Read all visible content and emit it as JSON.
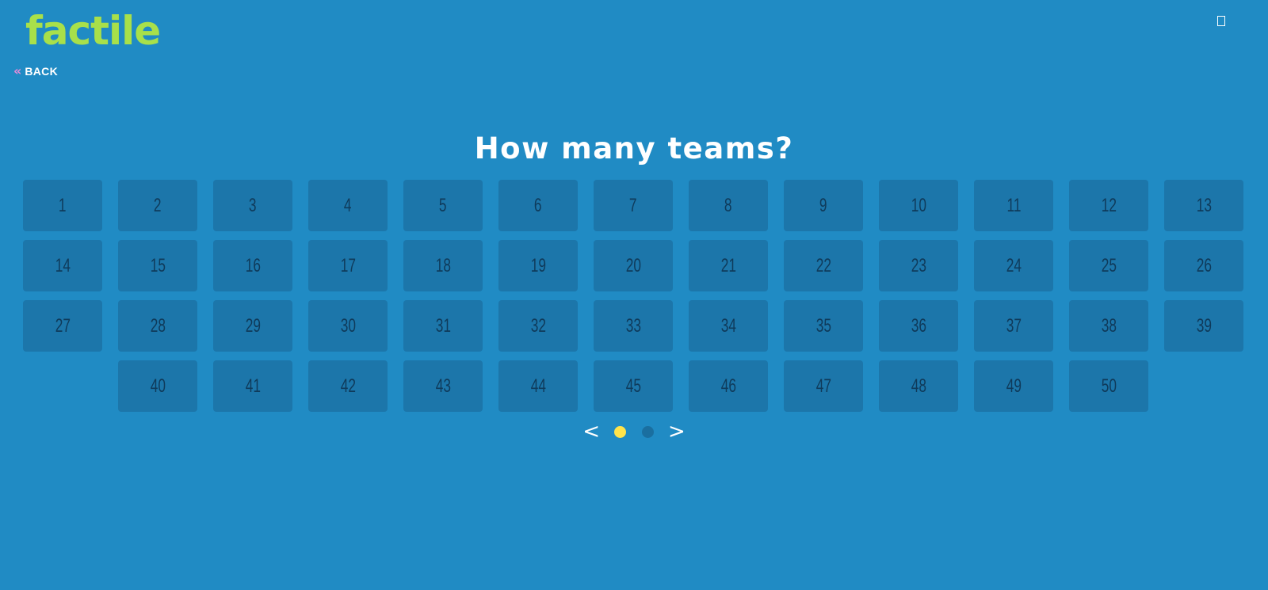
{
  "header": {
    "logo_text": "factile",
    "corner_icon": "square-outline-icon",
    "back_icon": "double-chevron-left-icon",
    "back_label": "BACK"
  },
  "main": {
    "title": "How many teams?",
    "teams": [
      "1",
      "2",
      "3",
      "4",
      "5",
      "6",
      "7",
      "8",
      "9",
      "10",
      "11",
      "12",
      "13",
      "14",
      "15",
      "16",
      "17",
      "18",
      "19",
      "20",
      "21",
      "22",
      "23",
      "24",
      "25",
      "26",
      "27",
      "28",
      "29",
      "30",
      "31",
      "32",
      "33",
      "34",
      "35",
      "36",
      "37",
      "38",
      "39",
      "40",
      "41",
      "42",
      "43",
      "44",
      "45",
      "46",
      "47",
      "48",
      "49",
      "50"
    ]
  },
  "pager": {
    "prev_label": "<",
    "next_label": ">",
    "page_count": 2,
    "active_page": 1
  },
  "colors": {
    "background": "#208bc4",
    "logo": "#a8e04a",
    "tile": "#1c76aa",
    "tile_text": "#0f3a5a",
    "active_dot": "#ffe44b",
    "inactive_dot": "#1a6fa0",
    "back_arrow": "#e48bd8"
  }
}
